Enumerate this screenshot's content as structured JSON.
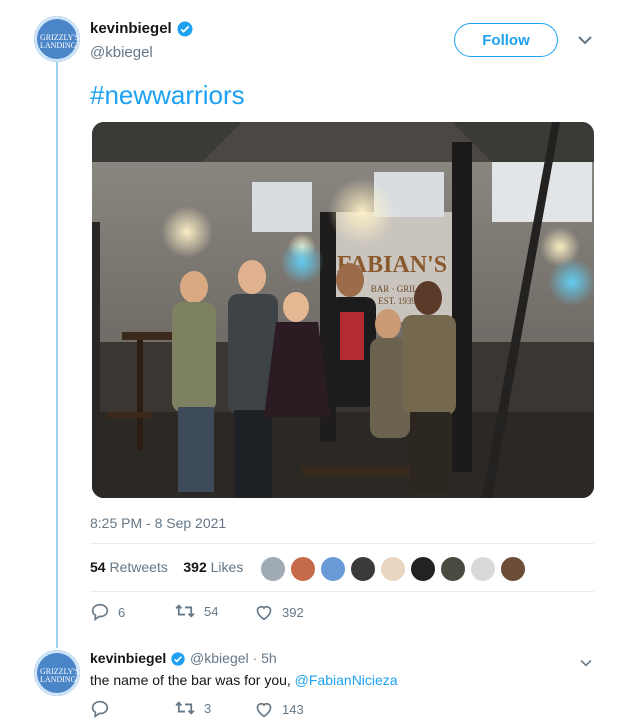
{
  "main_tweet": {
    "author_name": "kevinbiegel",
    "author_handle": "@kbiegel",
    "follow_label": "Follow",
    "text": "#newwarriors",
    "timestamp": "8:25 PM - 8 Sep 2021",
    "retweets_count": "54",
    "retweets_label": "Retweets",
    "likes_count": "392",
    "likes_label": "Likes",
    "replies": "6",
    "retweets": "54",
    "likes": "392"
  },
  "avatar_logo": "GRIZZLY'S LANDING",
  "reply_tweet": {
    "author_name": "kevinbiegel",
    "author_handle": "@kbiegel",
    "separator": "·",
    "time_ago": "5h",
    "text": "the name of the bar was for you,",
    "mention": "@FabianNicieza",
    "retweets": "3",
    "likes": "143"
  },
  "photo_sign": "FABIAN'S",
  "photo_sign_sub": "BAR · GRILL",
  "photo_sign_est": "EST. 1939",
  "colors": {
    "accent": "#1da1f2",
    "muted": "#657786",
    "like": "#e0245e",
    "thread": "#9ad3ee"
  },
  "likers": [
    "#a0aab4",
    "#c56b4a",
    "#6a9bd8",
    "#3a3a3a",
    "#e8d6c0",
    "#222222",
    "#4a4a40",
    "#d9d9d9",
    "#6b4d3a"
  ]
}
